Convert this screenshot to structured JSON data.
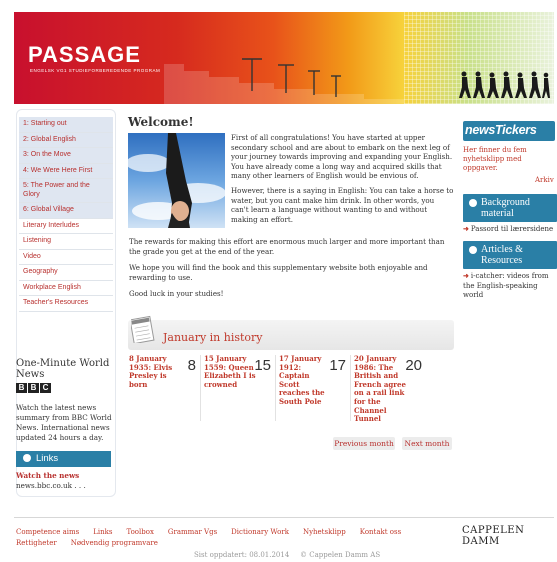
{
  "header": {
    "logo": "PASSAGE",
    "subtitle": "ENGELSK VG1 STUDIEFORBEREDENDE PROGRAM"
  },
  "sidebar": {
    "items": [
      {
        "label": "1: Starting out"
      },
      {
        "label": "2: Global English"
      },
      {
        "label": "3: On the Move"
      },
      {
        "label": "4: We Were Here First"
      },
      {
        "label": "5: The Power and the Glory"
      },
      {
        "label": "6: Global Village"
      },
      {
        "label": "Literary Interludes"
      },
      {
        "label": "Listening"
      },
      {
        "label": "Video"
      },
      {
        "label": "Geography"
      },
      {
        "label": "Workplace English"
      },
      {
        "label": "Teacher's Resources"
      }
    ],
    "bbc_title": "One-Minute World News",
    "bbc_logo": [
      "B",
      "B",
      "C"
    ],
    "bbc_desc": "Watch the latest news summary from BBC World News. International news updated 24 hours a day.",
    "links_label": "Links",
    "links_watch": "Watch the news",
    "links_url": "news.bbc.co.uk . . ."
  },
  "main": {
    "title": "Welcome!",
    "intro_p1": "First of all congratulations! You have started at upper secondary school and are about to embark on the next leg of your journey towards improving and expanding your English. You have already come a long way and acquired skills that many other learners of English would be envious of.",
    "intro_p2": "However, there is a saying in English: You can take a horse to water, but you cant make him drink. In other words, you can't learn a language without wanting to and without making an effort.",
    "p3": "The rewards for making this effort are enormous much larger and more important than the grade you get at the end of the year.",
    "p4": "We hope you will find the book and this supplementary website both enjoyable and rewarding to use.",
    "p5": "Good luck in your studies!",
    "history_title": "January in history",
    "days": [
      {
        "text": "8 January 1935: Elvis Presley is born",
        "num": "8"
      },
      {
        "text": "15 January 1559: Queen Elizabeth I is crowned",
        "num": "15"
      },
      {
        "text": "17 January 1912: Captain Scott reaches the South Pole",
        "num": "17"
      },
      {
        "text": "20 January 1986: The British and French agree on a rail link for the Channel Tunnel",
        "num": "20"
      }
    ],
    "prev_month": "Previous month",
    "next_month": "Next month"
  },
  "right": {
    "news_logo": "newsTickers",
    "news_text": "Her finner du fem nyhetsklipp med oppgaver.",
    "arkiv": "Arkiv",
    "bg_button": "Background material",
    "bg_sub": "Passord til lærersidene",
    "articles_button": "Articles & Resources",
    "articles_sub": "i-catcher: videos from the English-speaking world"
  },
  "footer": {
    "links": [
      "Competence aims",
      "Links",
      "Toolbox",
      "Grammar Vgs",
      "Dictionary Work",
      "Nyhetsklipp",
      "Kontakt oss",
      "Rettigheter",
      "Nødvendig programvare"
    ],
    "brand": "CAPPELEN DAMM",
    "updated": "Sist oppdatert: 08.01.2014",
    "copyright": "© Cappelen Damm AS"
  },
  "colors": {
    "accent_red": "#c0392b",
    "accent_blue": "#2a7fa6"
  }
}
